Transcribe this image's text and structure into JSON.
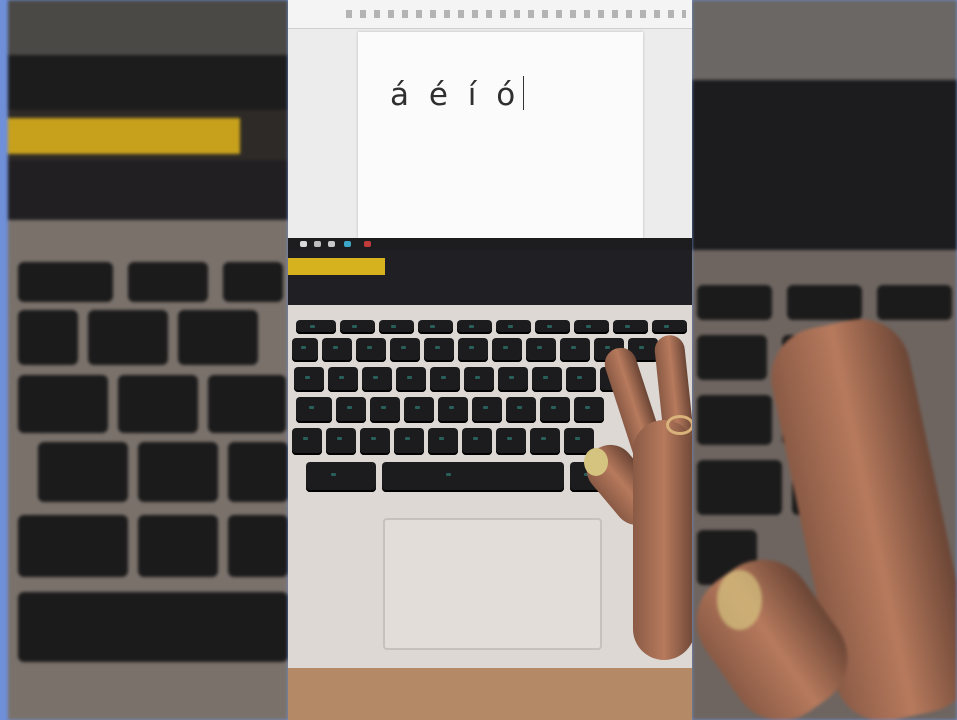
{
  "document": {
    "typed_text": "á é í ó"
  },
  "colors": {
    "side_bar": "#6f8fd8",
    "highlight_bar": "#d7b21f",
    "key": "#1c1c1e",
    "keyboard_deck": "#ddd8d4",
    "skin": "#b77a5d"
  }
}
